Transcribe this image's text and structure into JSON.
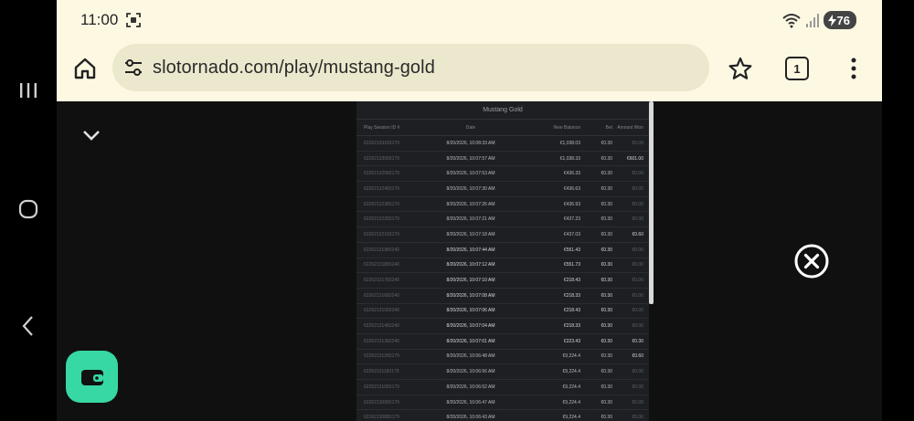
{
  "status": {
    "time": "11:00",
    "battery": "76"
  },
  "browser": {
    "url": "slotornado.com/play/mustang-gold",
    "tab_count": "1"
  },
  "panel": {
    "title": "Mustang Gold",
    "columns": [
      "Play Session ID #",
      "Date",
      "New Balance",
      "Bet",
      "Amount Won"
    ],
    "rows": [
      [
        "62262133183179",
        "8/20/2026, 10:08:33 AM",
        "€1,038.03",
        "€0.30",
        "€0.00"
      ],
      [
        "62262133083179",
        "8/20/2026, 10:07:57 AM",
        "€1,038.33",
        "€0.30",
        "€601.00"
      ],
      [
        "62262132583179",
        "8/20/2026, 10:07:53 AM",
        "€436.33",
        "€0.30",
        "€0.00"
      ],
      [
        "62262132483179",
        "8/20/2026, 10:07:30 AM",
        "€436.63",
        "€0.30",
        "€0.00"
      ],
      [
        "62262132383179",
        "8/20/2026, 10:07:26 AM",
        "€436.93",
        "€0.30",
        "€0.00"
      ],
      [
        "62262132283179",
        "8/20/2026, 10:07:21 AM",
        "€437.23",
        "€0.30",
        "€0.00"
      ],
      [
        "62262132183179",
        "8/20/2026, 10:07:18 AM",
        "€437.03",
        "€0.30",
        "€0.60"
      ],
      [
        "62262131983240",
        "8/20/2026, 10:07:44 AM",
        "€551.43",
        "€0.30",
        "€0.00"
      ],
      [
        "62262131883240",
        "8/20/2026, 10:07:12 AM",
        "€551.73",
        "€0.30",
        "€0.00"
      ],
      [
        "62262131783240",
        "8/20/2026, 10:07:10 AM",
        "€218.43",
        "€0.30",
        "€0.00"
      ],
      [
        "62262131683240",
        "8/20/2026, 10:07:08 AM",
        "€218.33",
        "€0.30",
        "€0.00"
      ],
      [
        "62262131583240",
        "8/20/2026, 10:07:06 AM",
        "€218.43",
        "€0.30",
        "€0.00"
      ],
      [
        "62262131483240",
        "8/20/2026, 10:07:04 AM",
        "€218.33",
        "€0.30",
        "€0.00"
      ],
      [
        "62262131383240",
        "8/20/2026, 10:07:01 AM",
        "€223.43",
        "€0.30",
        "€0.30"
      ],
      [
        "62262131283179",
        "8/20/2026, 10:06:48 AM",
        "€9,224.4",
        "€0.30",
        "€0.60"
      ],
      [
        "62262131183179",
        "8/20/2026, 10:06:56 AM",
        "€9,224.4",
        "€0.30",
        "€0.00"
      ],
      [
        "62262131083179",
        "8/20/2026, 10:06:52 AM",
        "€9,224.4",
        "€0.30",
        "€0.00"
      ],
      [
        "62262130983179",
        "8/20/2026, 10:06:47 AM",
        "€9,224.4",
        "€0.30",
        "€0.00"
      ],
      [
        "62262130883179",
        "8/20/2026, 10:06:43 AM",
        "€9,224.4",
        "€0.30",
        "€0.00"
      ]
    ]
  },
  "icons": {
    "nav_recents": "recents-icon",
    "nav_home": "home-circle-icon",
    "nav_back": "back-icon",
    "browser_home": "home-icon",
    "url_tune": "tune-icon",
    "bookmark": "star-icon",
    "menu": "more-vert-icon",
    "collapse": "chevron-down-icon",
    "close": "close-circle-icon",
    "wallet": "wallet-icon"
  },
  "colors": {
    "chrome_bg": "#fdf8e2",
    "urlbar_bg": "#ece8cd",
    "wallet_accent": "#37d8a4",
    "panel_bg": "#1d1f22"
  }
}
